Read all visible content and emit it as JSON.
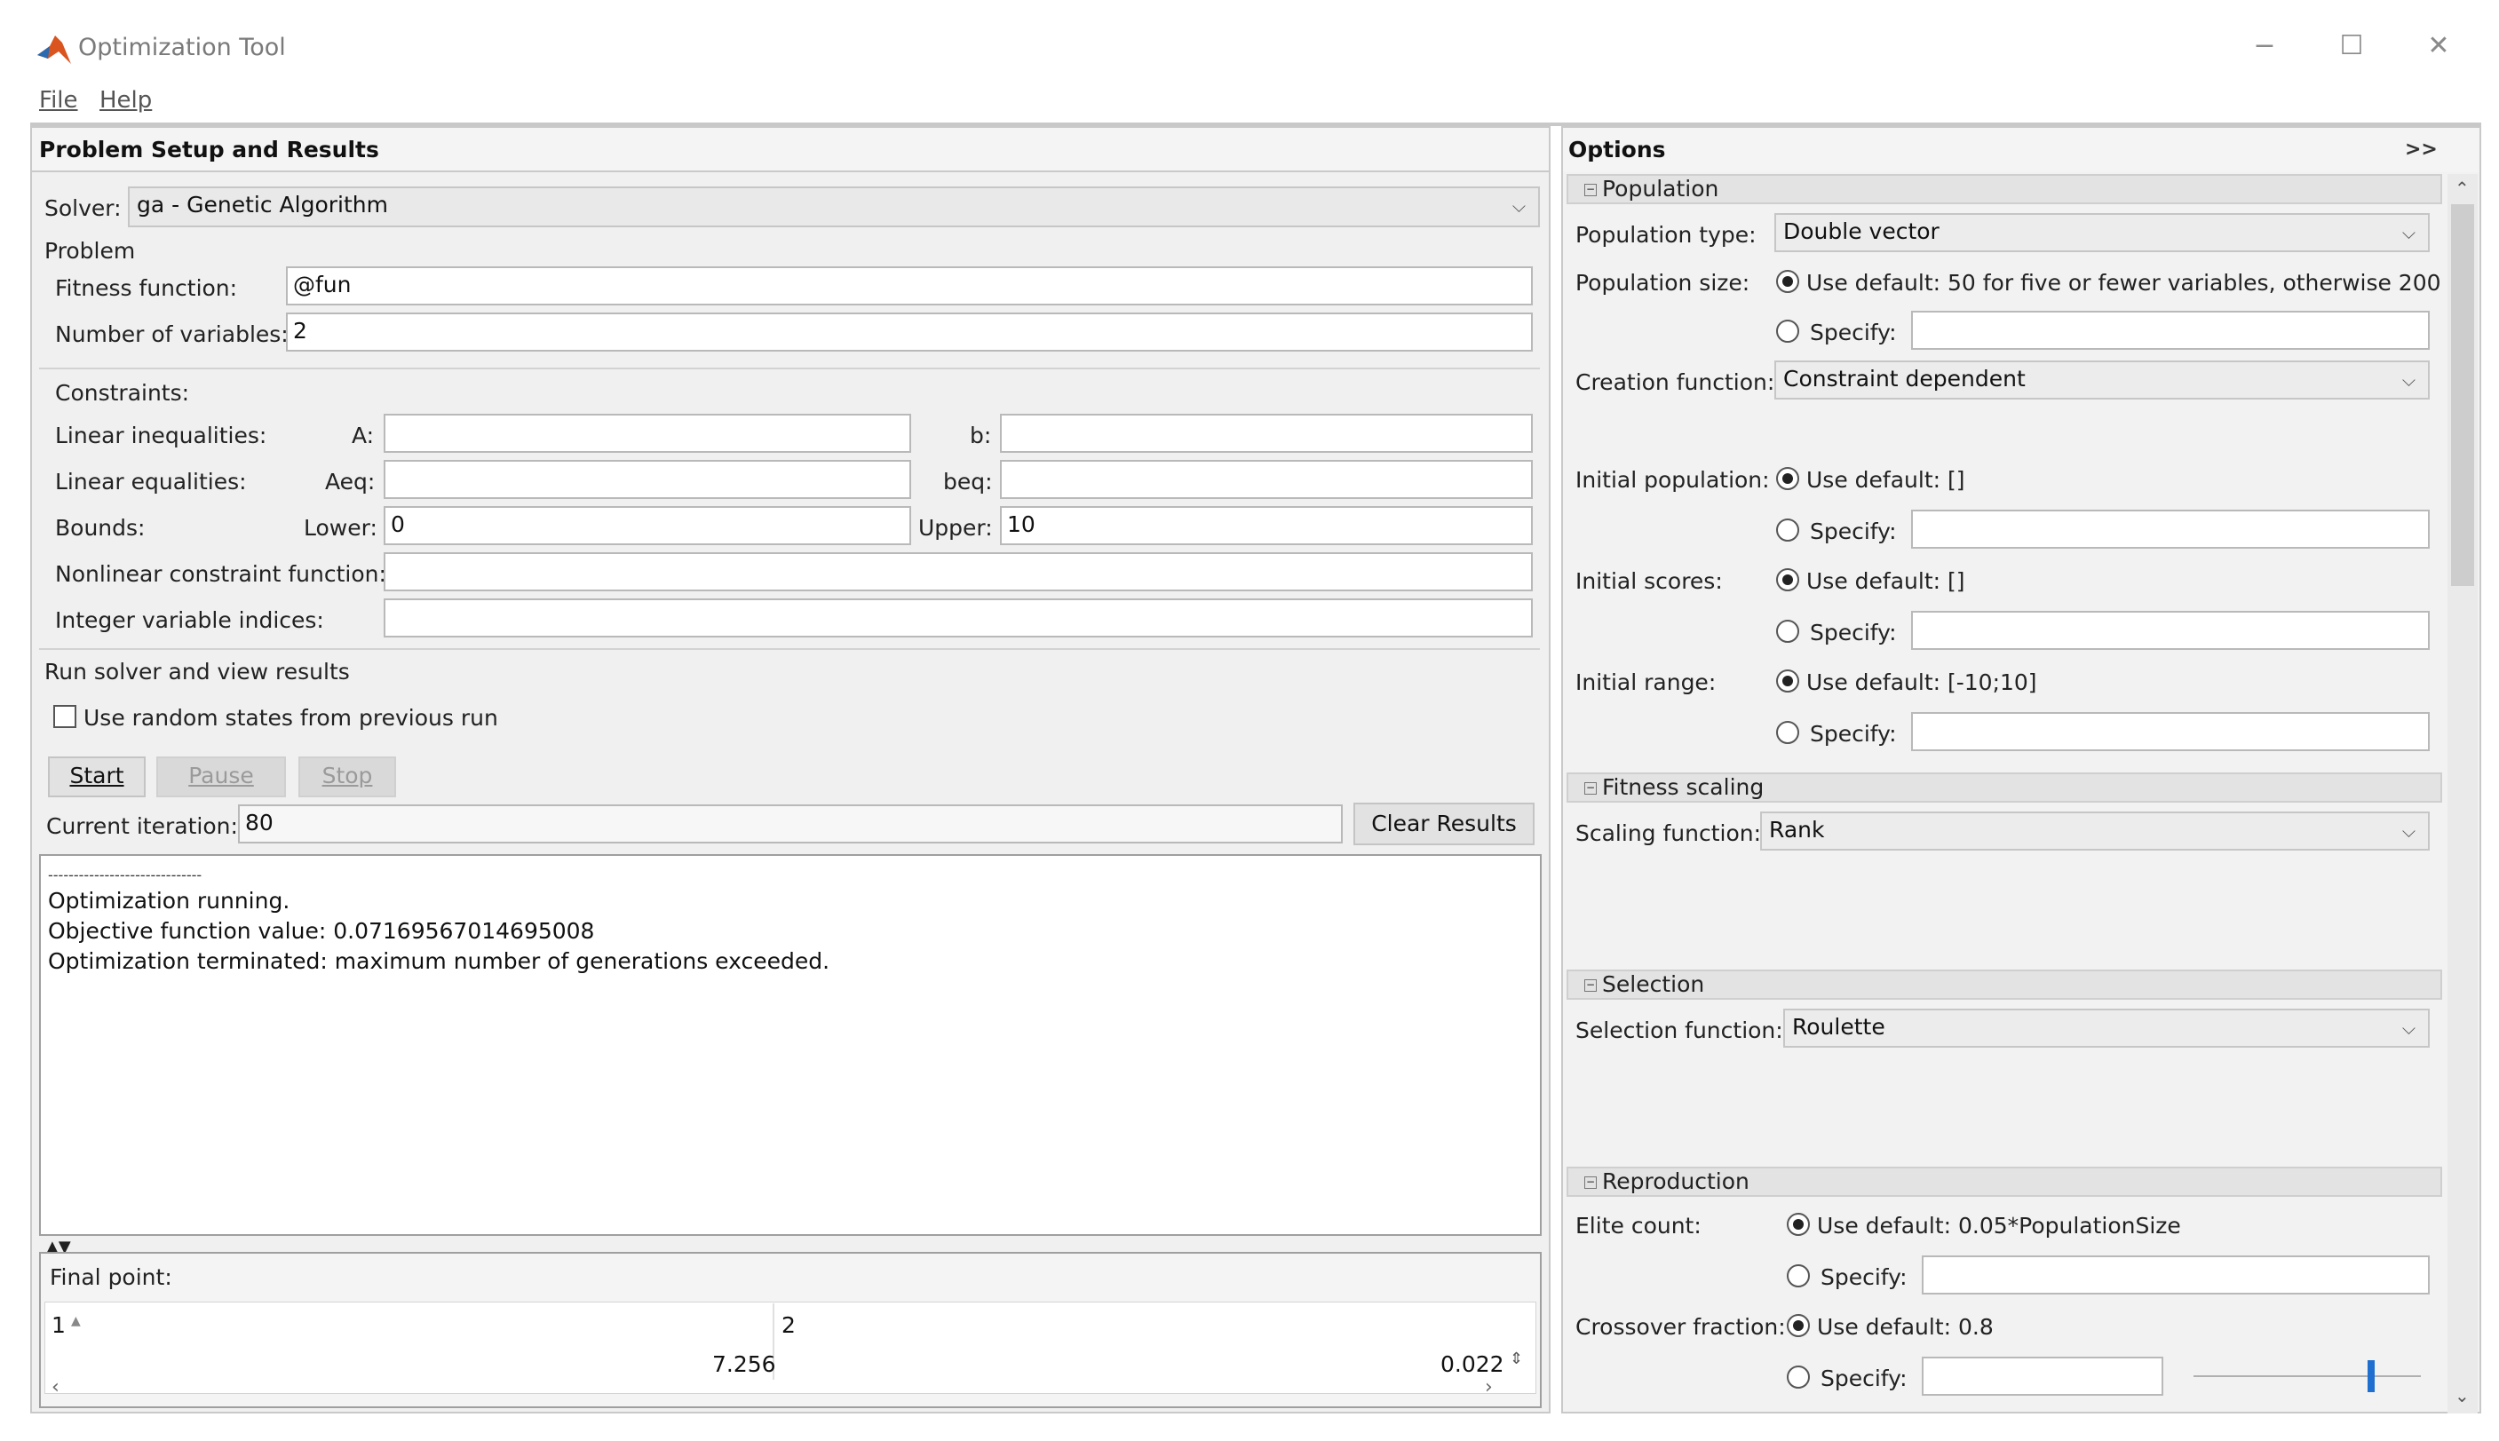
{
  "window": {
    "title": "Optimization Tool",
    "controls": {
      "minimize": "−",
      "maximize": "☐",
      "close": "✕"
    }
  },
  "menu": {
    "file": "File",
    "help": "Help"
  },
  "left": {
    "header": "Problem Setup and Results",
    "solver_label": "Solver:",
    "solver_value": "ga - Genetic Algorithm",
    "problem_label": "Problem",
    "fitness_label": "Fitness function:",
    "fitness_value": "@fun",
    "numvars_label": "Number of variables:",
    "numvars_value": "2",
    "constraints_label": "Constraints:",
    "lin_ineq_label": "Linear inequalities:",
    "A_label": "A:",
    "A_value": "",
    "b_label": "b:",
    "b_value": "",
    "lin_eq_label": "Linear equalities:",
    "Aeq_label": "Aeq:",
    "Aeq_value": "",
    "beq_label": "beq:",
    "beq_value": "",
    "bounds_label": "Bounds:",
    "lower_label": "Lower:",
    "lower_value": "0",
    "upper_label": "Upper:",
    "upper_value": "10",
    "nonlin_label": "Nonlinear constraint function:",
    "nonlin_value": "",
    "intvar_label": "Integer variable indices:",
    "intvar_value": "",
    "run_label": "Run solver and view results",
    "random_states_label": "Use random states from previous run",
    "start_label": "Start",
    "pause_label": "Pause",
    "stop_label": "Stop",
    "current_iter_label": "Current iteration:",
    "current_iter_value": "80",
    "clear_results_label": "Clear Results",
    "output_lines": [
      "------------------------------",
      "Optimization running.",
      "Objective function value: 0.07169567014695008",
      "Optimization terminated: maximum number of generations exceeded."
    ],
    "final_point_label": "Final point:",
    "final_point_col1": "1",
    "final_point_col2": "2",
    "final_point_val1": "7.256",
    "final_point_val2": "0.022"
  },
  "right": {
    "header": "Options",
    "expand_label": ">>",
    "population": {
      "title": "Population",
      "type_label": "Population type:",
      "type_value": "Double vector",
      "size_label": "Population size:",
      "size_default": "Use default: 50 for five or fewer variables, otherwise 200",
      "specify": "Specify:",
      "creation_label": "Creation function:",
      "creation_value": "Constraint dependent",
      "init_pop_label": "Initial population:",
      "init_pop_default": "Use default: []",
      "init_scores_label": "Initial scores:",
      "init_scores_default": "Use default: []",
      "init_range_label": "Initial range:",
      "init_range_default": "Use default: [-10;10]"
    },
    "fitness_scaling": {
      "title": "Fitness scaling",
      "scaling_label": "Scaling function:",
      "scaling_value": "Rank"
    },
    "selection": {
      "title": "Selection",
      "selection_label": "Selection function:",
      "selection_value": "Roulette"
    },
    "reproduction": {
      "title": "Reproduction",
      "elite_label": "Elite count:",
      "elite_default": "Use default: 0.05*PopulationSize",
      "crossover_label": "Crossover fraction:",
      "crossover_default": "Use default: 0.8",
      "specify": "Specify:"
    }
  },
  "colors": {
    "panel_bg": "#f0f0f0",
    "slider_thumb": "#1f6fd1",
    "matlab_orange": "#d9541e"
  }
}
